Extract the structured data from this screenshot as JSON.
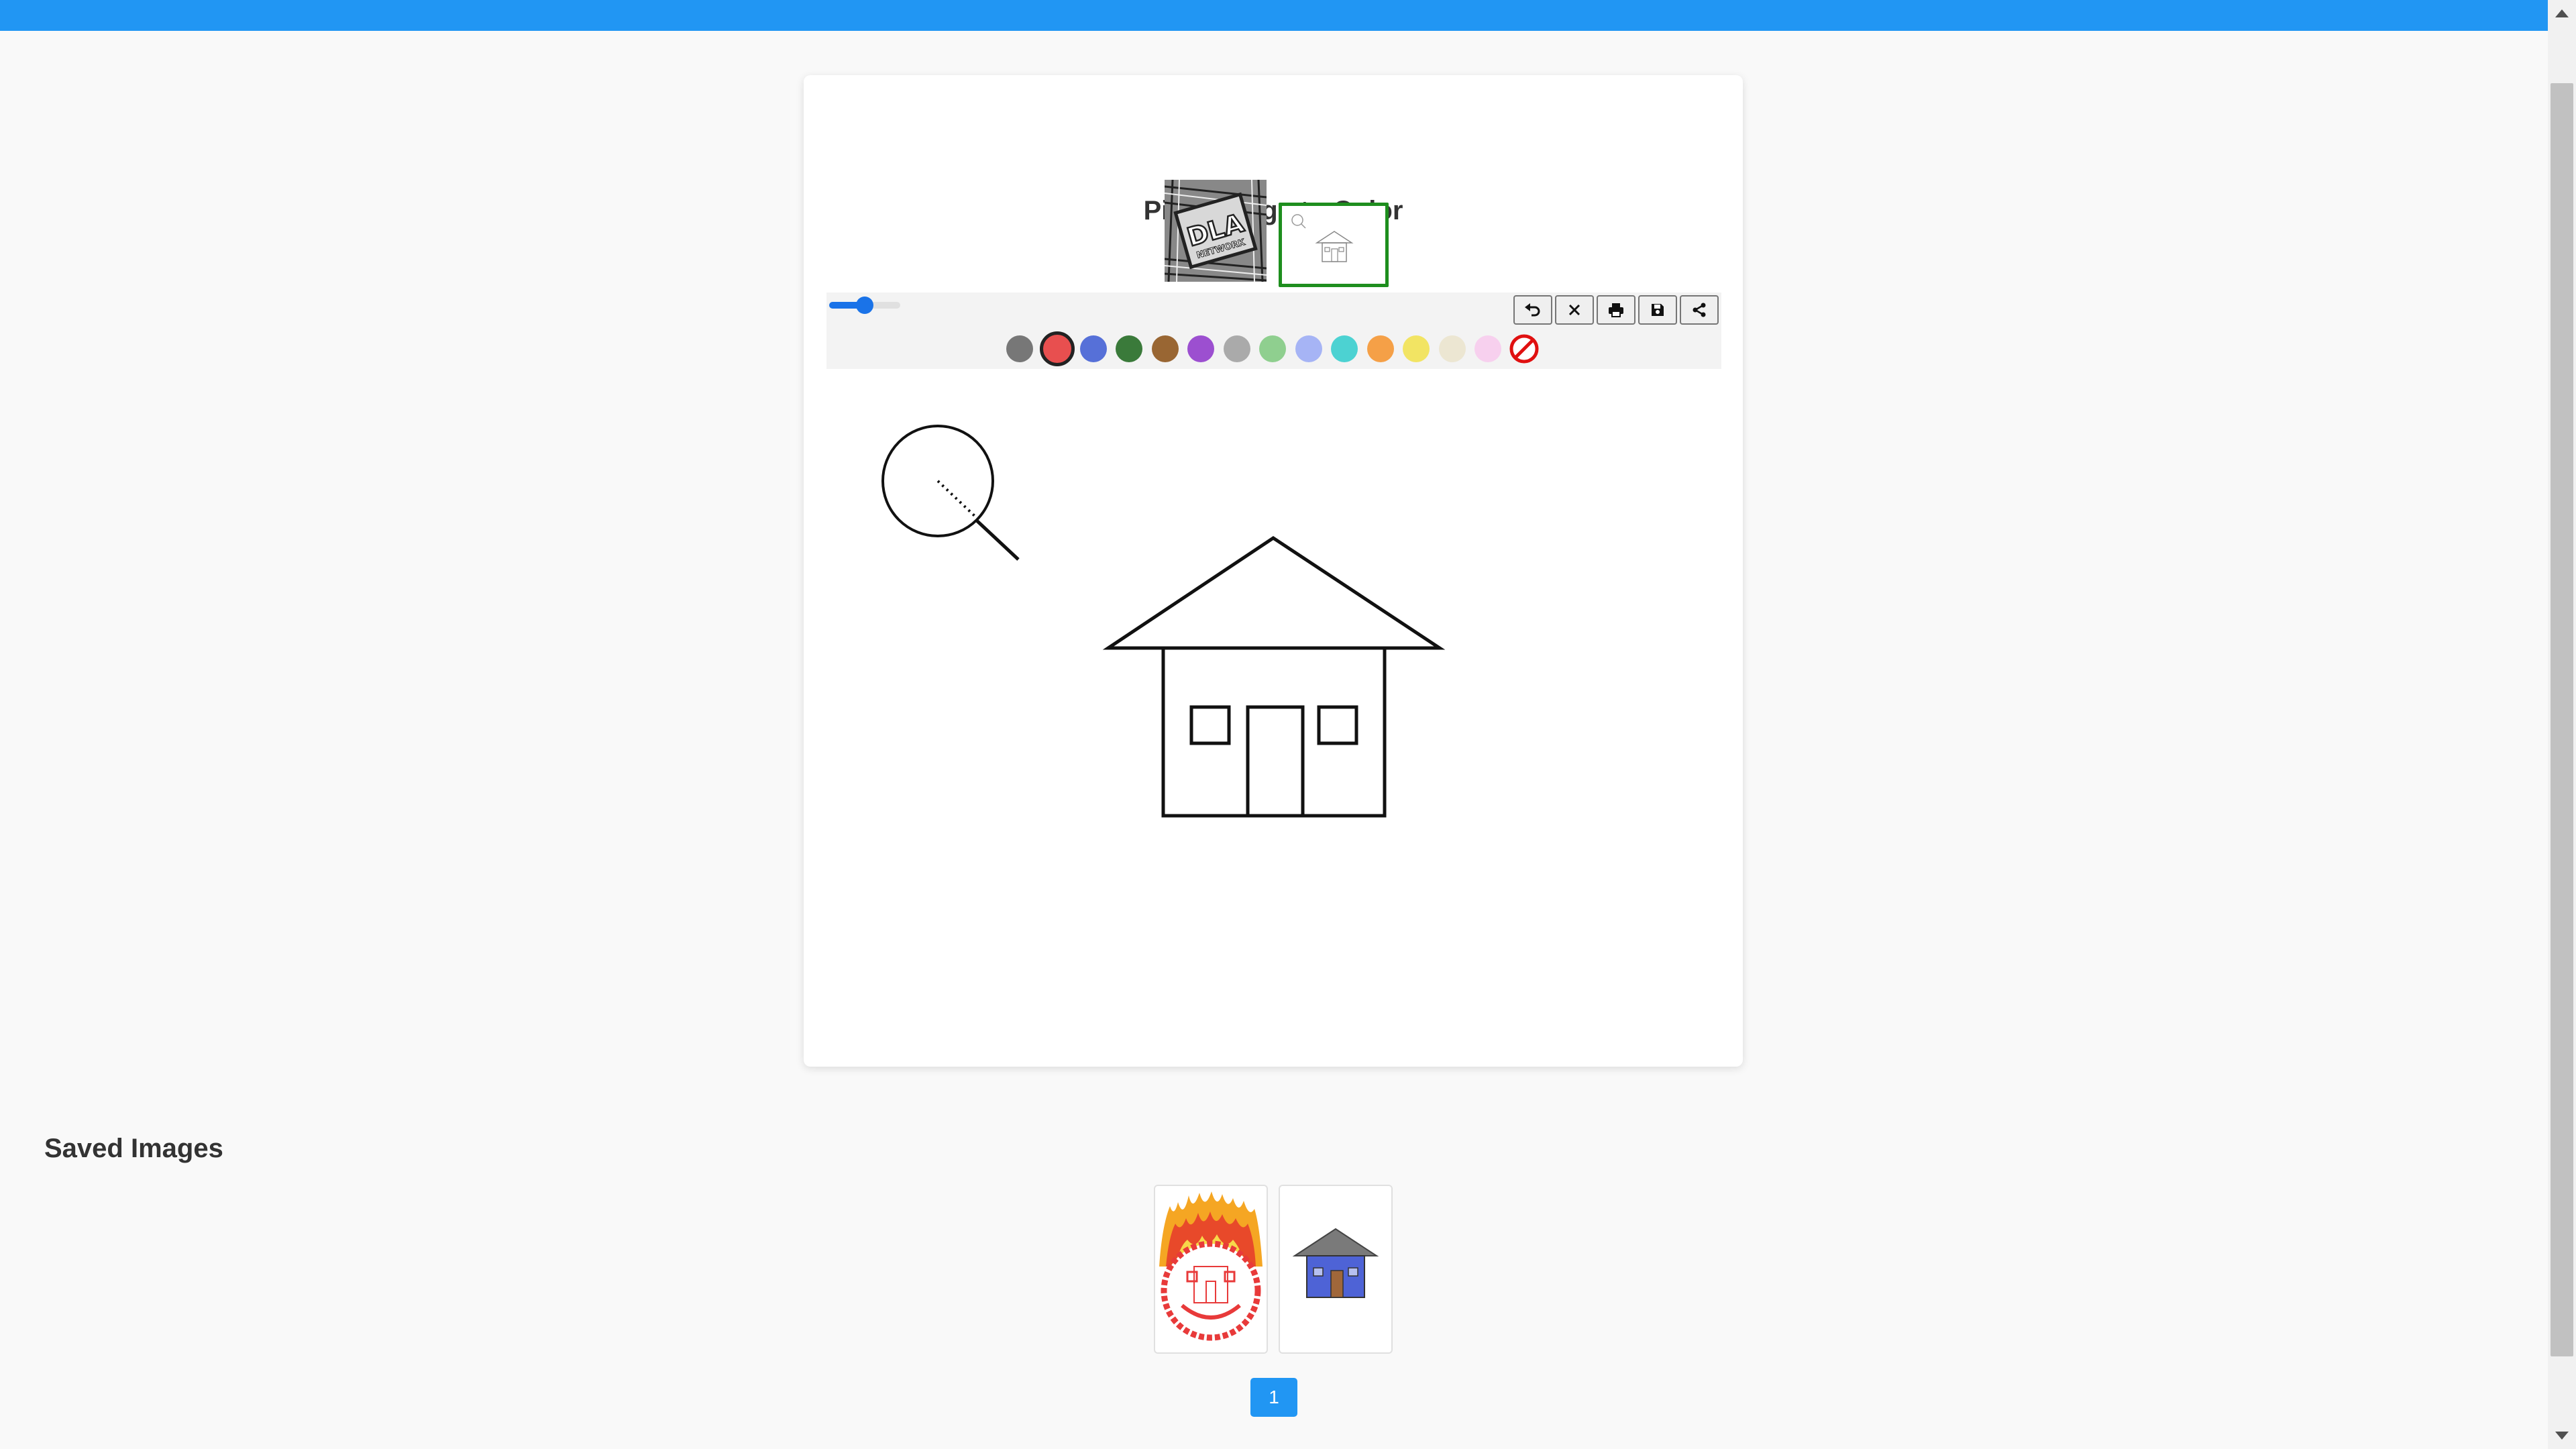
{
  "app": {
    "title": "Pick a Page to Color",
    "accent_color": "#2196f3"
  },
  "page_picker": {
    "pages": [
      {
        "name": "DLA Network",
        "icon": "dla-network-logo",
        "logo_text": "DLA",
        "logo_subtext": "NETWORK",
        "selected": false
      },
      {
        "name": "House",
        "icon": "house-outline-icon",
        "selected": true
      }
    ]
  },
  "toolbar": {
    "brush_size_value": 0.5,
    "buttons": [
      {
        "name": "undo",
        "icon": "undo-icon"
      },
      {
        "name": "clear",
        "icon": "close-icon"
      },
      {
        "name": "print",
        "icon": "print-icon"
      },
      {
        "name": "save",
        "icon": "save-icon"
      },
      {
        "name": "share",
        "icon": "share-icon"
      }
    ],
    "palette": [
      {
        "color": "#777777",
        "selected": false
      },
      {
        "color": "#e84f4f",
        "selected": true
      },
      {
        "color": "#5670d8",
        "selected": false
      },
      {
        "color": "#3a7a3a",
        "selected": false
      },
      {
        "color": "#996633",
        "selected": false
      },
      {
        "color": "#9c4fd0",
        "selected": false
      },
      {
        "color": "#aaaaaa",
        "selected": false
      },
      {
        "color": "#8fcf8f",
        "selected": false
      },
      {
        "color": "#a6b4f5",
        "selected": false
      },
      {
        "color": "#4cd2d2",
        "selected": false
      },
      {
        "color": "#f5a047",
        "selected": false
      },
      {
        "color": "#f2e463",
        "selected": false
      },
      {
        "color": "#ece6d2",
        "selected": false
      },
      {
        "color": "#f7d0ee",
        "selected": false
      }
    ],
    "eraser_icon": "no-color-icon"
  },
  "canvas": {
    "drawing": "house-outline",
    "zoom_icon": "magnifier-icon"
  },
  "saved": {
    "title": "Saved Images",
    "images": [
      {
        "name": "face-with-flames"
      },
      {
        "name": "blue-house"
      }
    ]
  },
  "pagination": {
    "current_page": "1"
  }
}
